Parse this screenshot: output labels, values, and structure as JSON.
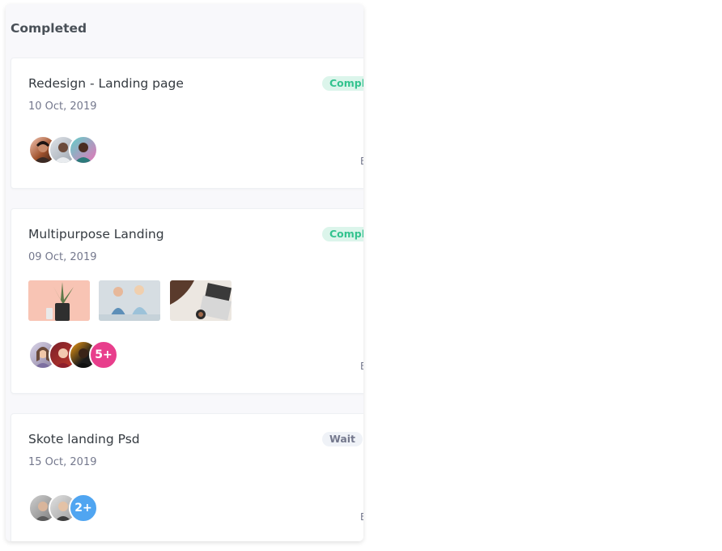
{
  "column": {
    "title": "Completed"
  },
  "cards": [
    {
      "title": "Redesign - Landing page",
      "date": "10 Oct, 2019",
      "badge": "Compl",
      "edge_text": "E"
    },
    {
      "title": "Multipurpose Landing",
      "date": "09 Oct, 2019",
      "badge": "Compl",
      "edge_text": "E",
      "more_members": "5+"
    },
    {
      "title": "Skote landing Psd",
      "date": "15 Oct, 2019",
      "badge": "Wait",
      "edge_text": "E",
      "more_members": "2+"
    }
  ],
  "colors": {
    "success_badge_bg": "#dcf5eb",
    "success_badge_text": "#34c38f",
    "waiting_badge_bg": "#eff2f7",
    "waiting_badge_text": "#74788d",
    "more_pink": "#e83e8c",
    "more_blue": "#50a5f1"
  }
}
